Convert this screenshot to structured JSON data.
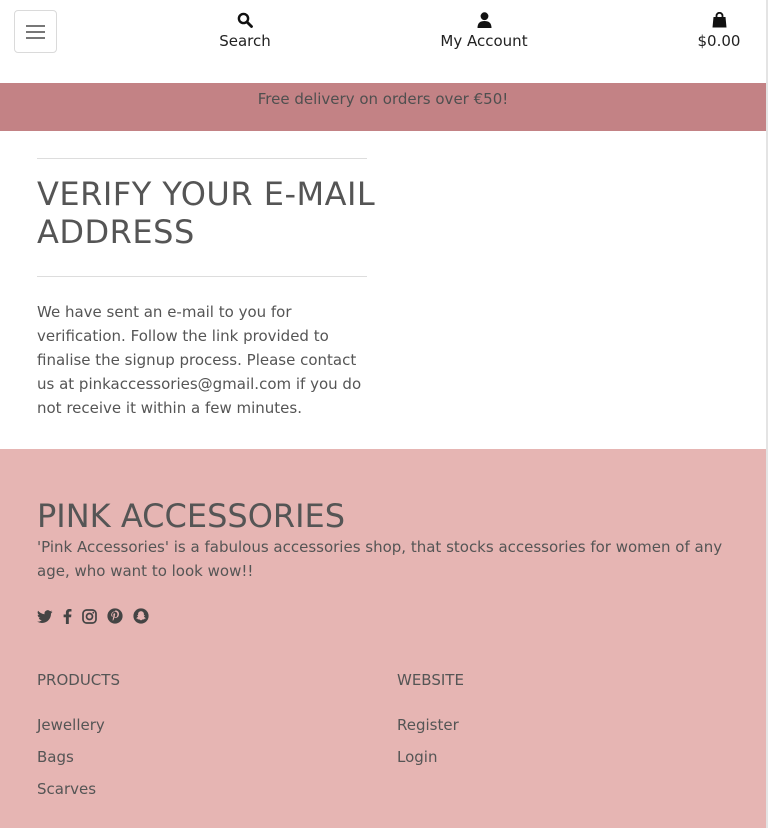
{
  "header": {
    "search_label": "Search",
    "account_label": "My Account",
    "cart_total": "$0.00",
    "icons": {
      "menu": "hamburger-icon",
      "search": "search-icon",
      "account": "user-icon",
      "cart": "shopping-bag-icon"
    }
  },
  "banner": {
    "text": "Free delivery on orders over €50!"
  },
  "main": {
    "title": "VERIFY YOUR E-MAIL ADDRESS",
    "message": "We have sent an e-mail to you for verification. Follow the link provided to finalise the signup process. Please contact us at pinkaccessories@gmail.com if you do not receive it within a few minutes."
  },
  "footer": {
    "brand": "PINK ACCESSORIES",
    "tagline": "'Pink Accessories' is a fabulous accessories shop, that stocks accessories for women of any age, who want to look wow!!",
    "socials": [
      "twitter-icon",
      "facebook-icon",
      "instagram-icon",
      "pinterest-icon",
      "snapchat-icon"
    ],
    "products": {
      "title": "PRODUCTS",
      "links": [
        "Jewellery",
        "Bags",
        "Scarves"
      ]
    },
    "website": {
      "title": "WEBSITE",
      "links": [
        "Register",
        "Login"
      ]
    }
  },
  "colors": {
    "banner_bg": "#c38285",
    "footer_bg": "#e6b5b3",
    "text": "#555555"
  }
}
